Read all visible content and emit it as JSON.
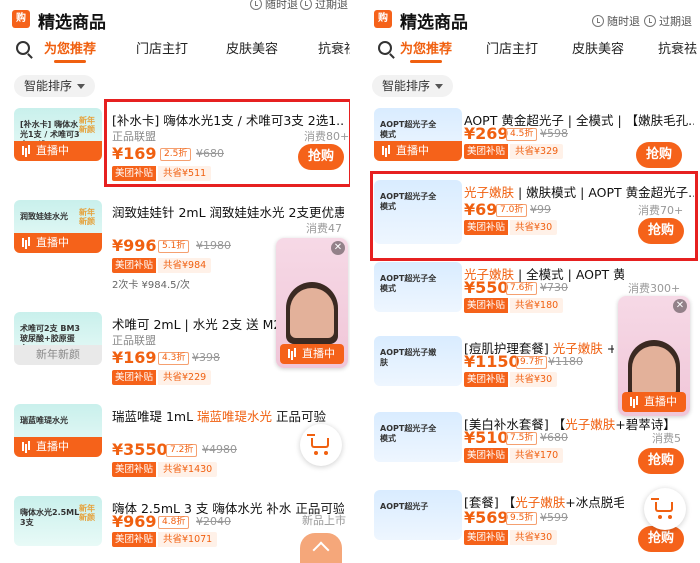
{
  "header": {
    "logo": "购",
    "title": "精选商品",
    "opt_return": "随时退",
    "opt_refund": "过期退"
  },
  "tabs": [
    "为您推荐",
    "门店主打",
    "皮肤美容",
    "抗衰祛"
  ],
  "sort_label": "智能排序",
  "live_label": "直播中",
  "new_label": "新年新颜",
  "buy_label": "抢购",
  "tag_subsidy": "美团补贴",
  "float_live": "直播中",
  "left_products": [
    {
      "thumb": "[补水卡] 嗨体水光1支 / 术唯可3支 二选一",
      "badge": "新年新颜",
      "name": "[补水卡] 嗨体水光1支 / 术唯可3支 2选1...",
      "sub": "正品联盟",
      "sold": "消费80+",
      "price": "¥169",
      "disc": "2.5折",
      "orig": "¥680",
      "save": "共省¥511"
    },
    {
      "thumb": "润致娃娃水光",
      "badge": "新年新颜",
      "name": "润致娃娃针 2mL 润致娃娃水光 2支更优惠",
      "sub": "",
      "sold": "消费47",
      "price": "¥996",
      "disc": "5.1折",
      "orig": "¥1980",
      "save": "共省¥984",
      "extra": "2次卡 ¥984.5/次"
    },
    {
      "thumb": "术唯可2支 BM3玻尿酸+胶原蛋白",
      "badge": "",
      "name": "术唯可 2mL | 水光 2支 送 M22",
      "sub": "正品联盟",
      "sold": "",
      "price": "¥169",
      "disc": "4.3折",
      "orig": "¥398",
      "save": "共省¥229"
    },
    {
      "thumb": "瑞蓝唯瑅水光",
      "badge": "",
      "name": "瑞蓝唯瑅 1mL ",
      "name_hl": "瑞蓝唯瑅水光",
      "name_tail": " 正品可验",
      "sub": "",
      "sold": "",
      "price": "¥3550",
      "disc": "7.2折",
      "orig": "¥4980",
      "save": "共省¥1430"
    },
    {
      "thumb": "嗨体水光2.5ML 3支",
      "badge": "新年新颜",
      "name": "嗨体 2.5mL 3 支 嗨体水光 补水 正品可验",
      "sub": "",
      "sold": "新品上市",
      "price": "¥969",
      "disc": "4.8折",
      "orig": "¥2040",
      "save": "共省¥1071"
    }
  ],
  "right_products": [
    {
      "thumb": "AOPT超光子全模式",
      "name": "AOPT 黄金超光子 | 全模式 | 【嫩肤毛孔...",
      "sub": "",
      "sold": "",
      "price": "¥269",
      "disc": "4.5折",
      "orig": "¥598",
      "save": "共省¥329"
    },
    {
      "thumb": "AOPT超光子全模式",
      "name_hl": "光子嫩肤",
      "name": " | 嫩肤模式 | AOPT 黄金超光子...",
      "sub": "",
      "sold": "消费70+",
      "price": "¥69",
      "disc": "7.0折",
      "orig": "¥99",
      "save": "共省¥30"
    },
    {
      "thumb": "AOPT超光子全模式",
      "name_hl": "光子嫩肤",
      "name": " | 全模式 | AOPT 黄金超光子",
      "sub": "",
      "sold": "消费300+",
      "price": "¥550",
      "disc": "7.6折",
      "orig": "¥730",
      "save": "共省¥180"
    },
    {
      "thumb": "AOPT超光子嫩肤",
      "name": "[痘肌护理套餐] ",
      "name_hl": "光子嫩肤",
      "name_tail": " + 一缘",
      "sub": "",
      "sold": "",
      "price": "¥1150",
      "disc": "9.7折",
      "orig": "¥1180",
      "save": "共省¥30"
    },
    {
      "thumb": "AOPT超光子全模式",
      "name": "[美白补水套餐] 【",
      "name_hl": "光子嫩肤",
      "name_tail": "+碧萃诗】",
      "sub": "",
      "sold": "消费5",
      "price": "¥510",
      "disc": "7.5折",
      "orig": "¥680",
      "save": "共省¥170"
    },
    {
      "thumb": "AOPT超光子",
      "name": "[套餐] 【",
      "name_hl": "光子嫩肤",
      "name_tail": "+冰点脱毛】 超光",
      "sub": "",
      "sold": "",
      "price": "¥569",
      "disc": "9.5折",
      "orig": "¥599",
      "save": "共省¥30"
    }
  ]
}
